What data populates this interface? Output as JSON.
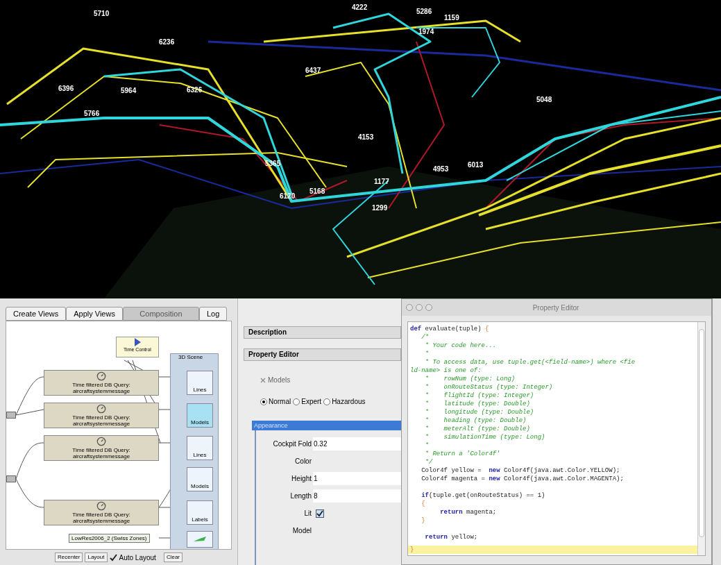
{
  "visualization": {
    "flight_labels": [
      "5710",
      "4222",
      "5286",
      "1159",
      "1974",
      "6236",
      "6437",
      "6396",
      "5964",
      "6326",
      "5766",
      "5048",
      "4153",
      "5365",
      "4953",
      "6013",
      "6120",
      "5168",
      "1177",
      "1299"
    ]
  },
  "composer": {
    "tabs": [
      {
        "label": "Create Views",
        "selected": false
      },
      {
        "label": "Apply Views",
        "selected": false
      },
      {
        "label": "Composition",
        "selected": true
      },
      {
        "label": "Log",
        "selected": false
      }
    ],
    "time_control": "Time Control",
    "queries": [
      "Time filtered DB Query: aircraftsystemmessage",
      "Time filtered DB Query: aircraftsystemmessage",
      "Time filtered DB Query: aircraftsystemmessage",
      "Time filtered DB Query: aircraftsystemmessage"
    ],
    "scene": {
      "title": "3D Scene",
      "nodes": [
        {
          "label": "Lines",
          "selected": false
        },
        {
          "label": "Models",
          "selected": true
        },
        {
          "label": "Lines",
          "selected": false
        },
        {
          "label": "Models",
          "selected": false
        },
        {
          "label": "Labels",
          "selected": false
        }
      ]
    },
    "terrain": "LowRes2006_2 (Swiss Zones)",
    "buttons": [
      "Recenter",
      "Layout",
      "Clear"
    ],
    "auto_layout": {
      "label": "Auto Layout",
      "checked": true
    }
  },
  "properties": {
    "sections": [
      "Description",
      "Property Editor"
    ],
    "models": {
      "label": "Models",
      "checked": false
    },
    "modes": [
      {
        "label": "Normal",
        "selected": true
      },
      {
        "label": "Expert",
        "selected": false
      },
      {
        "label": "Hazardous",
        "selected": false
      }
    ],
    "group": "Appearance",
    "rows": [
      {
        "kind": "field",
        "label": "Cockpit Fold",
        "value": "0.32"
      },
      {
        "kind": "label",
        "label": "Color"
      },
      {
        "kind": "field",
        "label": "Height",
        "value": "1"
      },
      {
        "kind": "field",
        "label": "Length",
        "value": "8"
      },
      {
        "kind": "checkbox",
        "label": "Lit",
        "checked": true
      },
      {
        "kind": "label",
        "label": "Model"
      }
    ]
  },
  "editor": {
    "title": "Property Editor",
    "lines": [
      {
        "kind": "code",
        "segments": [
          {
            "kind": "keyword",
            "text": "def"
          },
          {
            "kind": "plain",
            "text": " evaluate(tuple) "
          },
          {
            "kind": "brace",
            "text": "{"
          }
        ]
      },
      {
        "kind": "code",
        "segments": [
          {
            "kind": "comment",
            "text": "   /*"
          }
        ]
      },
      {
        "kind": "code",
        "segments": [
          {
            "kind": "comment",
            "text": "    * Your code here..."
          }
        ]
      },
      {
        "kind": "code",
        "segments": [
          {
            "kind": "comment",
            "text": "    *"
          }
        ]
      },
      {
        "kind": "code",
        "segments": [
          {
            "kind": "comment",
            "text": "    * To access data, use tuple.get(<field-name>) where <fie"
          }
        ]
      },
      {
        "kind": "code",
        "segments": [
          {
            "kind": "comment",
            "text": "ld-name> is one of:"
          }
        ]
      },
      {
        "kind": "code",
        "segments": [
          {
            "kind": "comment",
            "text": "    *    rowNum (type: Long)"
          }
        ]
      },
      {
        "kind": "code",
        "segments": [
          {
            "kind": "comment",
            "text": "    *    onRouteStatus (type: Integer)"
          }
        ]
      },
      {
        "kind": "code",
        "segments": [
          {
            "kind": "comment",
            "text": "    *    flightId (type: Integer)"
          }
        ]
      },
      {
        "kind": "code",
        "segments": [
          {
            "kind": "comment",
            "text": "    *    latitude (type: Double)"
          }
        ]
      },
      {
        "kind": "code",
        "segments": [
          {
            "kind": "comment",
            "text": "    *    longitude (type: Double)"
          }
        ]
      },
      {
        "kind": "code",
        "segments": [
          {
            "kind": "comment",
            "text": "    *    heading (type: Double)"
          }
        ]
      },
      {
        "kind": "code",
        "segments": [
          {
            "kind": "comment",
            "text": "    *    meterAlt (type: Double)"
          }
        ]
      },
      {
        "kind": "code",
        "segments": [
          {
            "kind": "comment",
            "text": "    *    simulationTime (type: Long)"
          }
        ]
      },
      {
        "kind": "code",
        "segments": [
          {
            "kind": "comment",
            "text": "    *"
          }
        ]
      },
      {
        "kind": "code",
        "segments": [
          {
            "kind": "comment",
            "text": "    * Return a 'Color4f'"
          }
        ]
      },
      {
        "kind": "code",
        "segments": [
          {
            "kind": "comment",
            "text": "    */"
          }
        ]
      },
      {
        "kind": "code",
        "segments": [
          {
            "kind": "plain",
            "text": "   Color4f yellow =  "
          },
          {
            "kind": "keyword",
            "text": "new"
          },
          {
            "kind": "plain",
            "text": " Color4f(java.awt.Color.YELLOW);"
          }
        ]
      },
      {
        "kind": "code",
        "segments": [
          {
            "kind": "plain",
            "text": "   Color4f magenta = "
          },
          {
            "kind": "keyword",
            "text": "new"
          },
          {
            "kind": "plain",
            "text": " Color4f(java.awt.Color.MAGENTA);"
          }
        ]
      },
      {
        "kind": "blank"
      },
      {
        "kind": "code",
        "segments": [
          {
            "kind": "keyword",
            "text": "   if"
          },
          {
            "kind": "plain",
            "text": "(tuple.get(onRouteStatus) == 1)"
          }
        ]
      },
      {
        "kind": "code",
        "segments": [
          {
            "kind": "brace",
            "text": "   {"
          }
        ]
      },
      {
        "kind": "code",
        "segments": [
          {
            "kind": "keyword",
            "text": "        return"
          },
          {
            "kind": "plain",
            "text": " magenta;"
          }
        ]
      },
      {
        "kind": "code",
        "segments": [
          {
            "kind": "brace",
            "text": "   }"
          }
        ]
      },
      {
        "kind": "blank"
      },
      {
        "kind": "code",
        "segments": [
          {
            "kind": "keyword",
            "text": "    return"
          },
          {
            "kind": "plain",
            "text": " yellow;"
          }
        ]
      },
      {
        "kind": "code",
        "segments": [
          {
            "kind": "brace",
            "text": "}"
          }
        ]
      }
    ]
  }
}
